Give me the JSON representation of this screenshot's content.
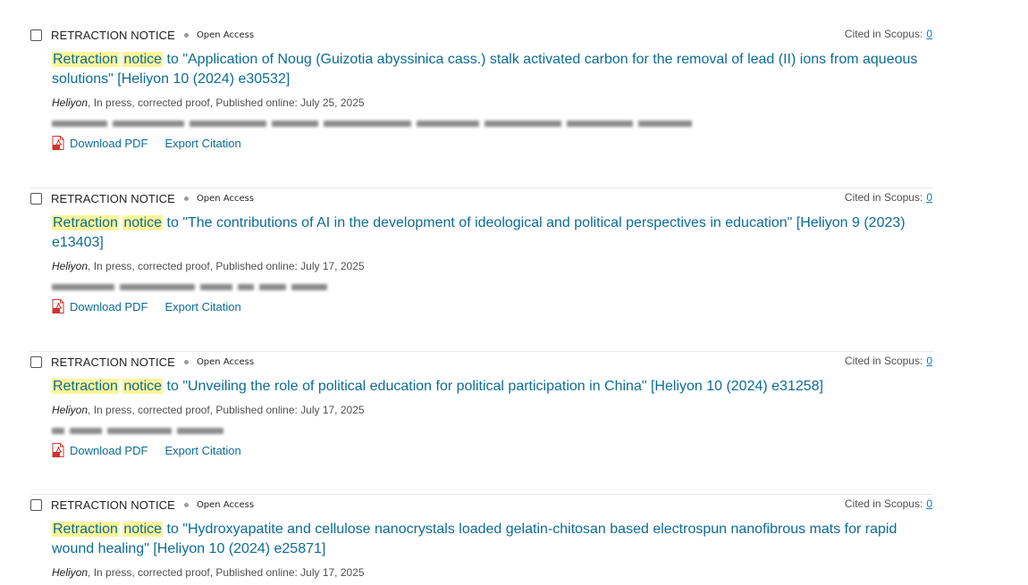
{
  "colors": {
    "link": "#0c6c95",
    "highlight": "#fdf59a",
    "cited_link": "#0c7dbb",
    "pdf_red": "#d0312d"
  },
  "labels": {
    "download_pdf": "Download PDF",
    "export_citation": "Export Citation",
    "cited_in_scopus": "Cited in Scopus:"
  },
  "results": [
    {
      "article_type": "RETRACTION NOTICE",
      "access": "Open Access",
      "cited_count": "0",
      "title_hl_1": "Retraction",
      "title_hl_2": "notice",
      "title_rest": " to \"Application of Noug (Guizotia abyssinica cass.) stalk activated carbon for the removal of lead (II) ions from aqueous solutions\" [Heliyon 10 (2024) e30532]",
      "journal": "Heliyon",
      "source_rest": ", In press, corrected proof, Published online: July 25, 2025",
      "icon": "pdf-icon"
    },
    {
      "article_type": "RETRACTION NOTICE",
      "access": "Open Access",
      "cited_count": "0",
      "title_hl_1": "Retraction",
      "title_hl_2": "notice",
      "title_rest": " to \"The contributions of AI in the development of ideological and political perspectives in education\" [Heliyon 9 (2023) e13403]",
      "journal": "Heliyon",
      "source_rest": ", In press, corrected proof, Published online: July 17, 2025",
      "icon": "pdf-icon"
    },
    {
      "article_type": "RETRACTION NOTICE",
      "access": "Open Access",
      "cited_count": "0",
      "title_hl_1": "Retraction",
      "title_hl_2": "notice",
      "title_rest": " to \"Unveiling the role of political education for political participation in China\" [Heliyon 10 (2024) e31258]",
      "journal": "Heliyon",
      "source_rest": ", In press, corrected proof, Published online: July 17, 2025",
      "icon": "pdf-icon"
    },
    {
      "article_type": "RETRACTION NOTICE",
      "access": "Open Access",
      "cited_count": "0",
      "title_hl_1": "Retraction",
      "title_hl_2": "notice",
      "title_rest": " to \"Hydroxyapatite and cellulose nanocrystals loaded gelatin-chitosan based electrospun nanofibrous mats for rapid wound healing\" [Heliyon 10 (2024) e25871]",
      "journal": "Heliyon",
      "source_rest": ", In press, corrected proof, Published online: July 17, 2025"
    }
  ]
}
